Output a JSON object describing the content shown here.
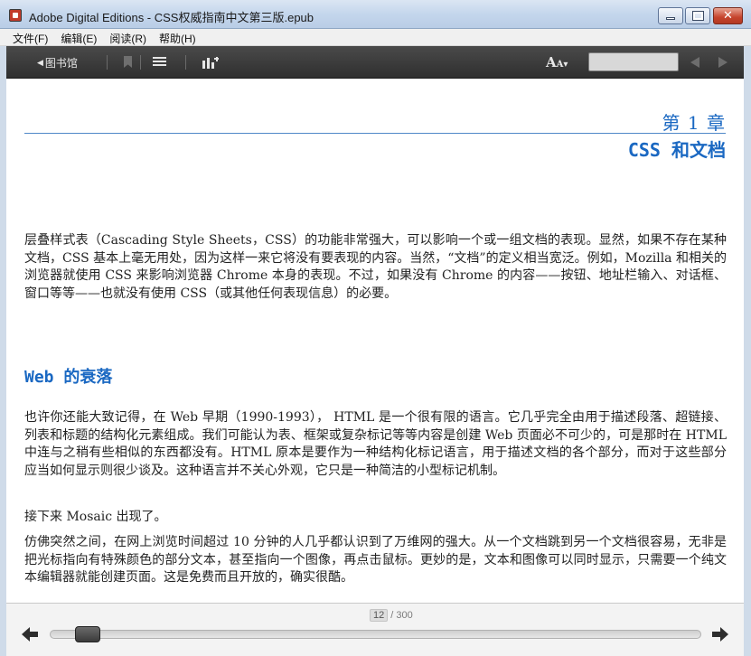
{
  "window": {
    "title": "Adobe Digital Editions - CSS权威指南中文第三版.epub"
  },
  "menu": [
    "文件(F)",
    "编辑(E)",
    "阅读(R)",
    "帮助(H)"
  ],
  "toolbar": {
    "library_label": "图书馆",
    "library_arrow": "◀",
    "font_size_label": "A",
    "font_size_small": "A▾",
    "search_placeholder": ""
  },
  "content": {
    "chapter_number": "第 1 章",
    "chapter_title": "CSS 和文档",
    "paragraph_1": "层叠样式表（Cascading Style Sheets，CSS）的功能非常强大，可以影响一个或一组文档的表现。显然，如果不存在某种文档，CSS 基本上毫无用处，因为这样一来它将没有要表现的内容。当然，“文档”的定义相当宽泛。例如，Mozilla 和相关的浏览器就使用 CSS 来影响浏览器 Chrome 本身的表现。不过，如果没有 Chrome 的内容——按钮、地址栏输入、对话框、窗口等等——也就没有使用 CSS（或其他任何表现信息）的必要。",
    "section_title": "Web 的衰落",
    "paragraph_2": "也许你还能大致记得，在 Web 早期（1990-1993）， HTML 是一个很有限的语言。它几乎完全由用于描述段落、超链接、列表和标题的结构化元素组成。我们可能认为表、框架或复杂标记等等内容是创建 Web 页面必不可少的，可是那时在 HTML 中连与之稍有些相似的东西都没有。HTML 原本是要作为一种结构化标记语言，用于描述文档的各个部分，而对于这些部分应当如何显示则很少谈及。这种语言并不关心外观，它只是一种简洁的小型标记机制。",
    "paragraph_3": "接下来 Mosaic 出现了。",
    "paragraph_4": "仿佛突然之间，在网上浏览时间超过 10 分钟的人几乎都认识到了万维网的强大。从一个文档跳到另一个文档很容易，无非是把光标指向有特殊颜色的部分文本，甚至指向一个图像，再点击鼠标。更妙的是，文本和图像可以同时显示，只需要一个纯文本编辑器就能创建页面。这是免费而且开放的，确实很酷。"
  },
  "navigation": {
    "current_page": "12",
    "total_pages": "/ 300",
    "progress_fraction": 0.04
  },
  "colors": {
    "accent": "#1a68c2",
    "toolbar_bg": "#3a3a3a"
  }
}
